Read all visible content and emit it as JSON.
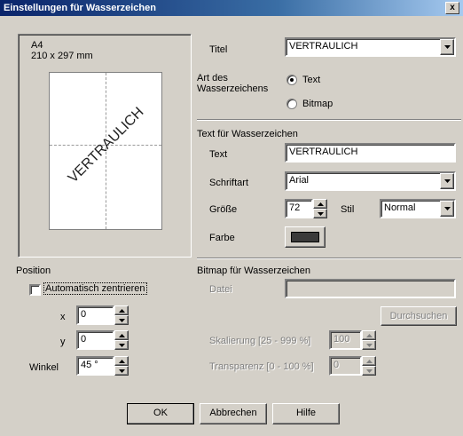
{
  "window": {
    "title": "Einstellungen für Wasserzeichen",
    "close_glyph": "x"
  },
  "preview": {
    "paper": "A4",
    "size": "210 x 297 mm",
    "watermark_text": "VERTRAULICH"
  },
  "settings": {
    "title_label": "Titel",
    "title_value": "VERTRAULICH",
    "type_label": "Art des Wasserzeichens",
    "type_label_line1": "Art des",
    "type_label_line2": "Wasserzeichens",
    "type_options": [
      {
        "label": "Text",
        "selected": true
      },
      {
        "label": "Bitmap",
        "selected": false
      }
    ]
  },
  "text_section": {
    "heading": "Text für Wasserzeichen",
    "text_label": "Text",
    "text_value": "VERTRAULICH",
    "font_label": "Schriftart",
    "font_value": "Arial",
    "size_label": "Größe",
    "size_value": "72",
    "style_label": "Stil",
    "style_value": "Normal",
    "color_label": "Farbe",
    "color_value": "#3a3a3a"
  },
  "bitmap_section": {
    "heading": "Bitmap für Wasserzeichen",
    "file_label": "Datei",
    "file_value": "",
    "browse_label": "Durchsuchen",
    "scale_label": "Skalierung [25 - 999 %]",
    "scale_value": "100",
    "transparency_label": "Transparenz [0 - 100 %]",
    "transparency_value": "0"
  },
  "position": {
    "heading": "Position",
    "auto_center_label": "Automatisch zentrieren",
    "auto_center_checked": false,
    "x_label": "x",
    "x_value": "0",
    "y_label": "y",
    "y_value": "0",
    "angle_label": "Winkel",
    "angle_value": "45 °"
  },
  "buttons": {
    "ok": "OK",
    "cancel": "Abbrechen",
    "help": "Hilfe"
  }
}
